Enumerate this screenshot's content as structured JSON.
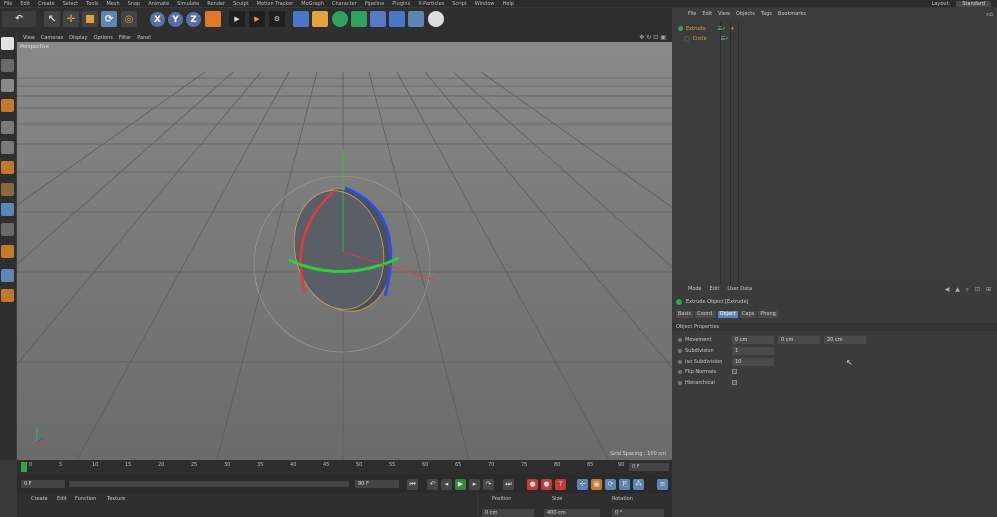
{
  "menubar": {
    "items": [
      "File",
      "Edit",
      "Create",
      "Select",
      "Tools",
      "Mesh",
      "Snap",
      "Animate",
      "Simulate",
      "Render",
      "Sculpt",
      "Motion Tracker",
      "MoGraph",
      "Character",
      "Pipeline",
      "Plugins",
      "X-Particles",
      "Script",
      "Window",
      "Help"
    ],
    "layout_label": "Layout:",
    "layout_value": "Standard"
  },
  "toolbar": {
    "x_label": "X",
    "y_label": "Y",
    "z_label": "Z"
  },
  "viewport": {
    "menu": [
      "View",
      "Cameras",
      "Display",
      "Options",
      "Filter",
      "Panel"
    ],
    "label": "Perspective",
    "grid_spacing": "Grid Spacing : 100 cm"
  },
  "timeline": {
    "ticks": [
      "0",
      "5",
      "10",
      "15",
      "20",
      "25",
      "30",
      "35",
      "40",
      "45",
      "50",
      "55",
      "60",
      "65",
      "70",
      "75",
      "80",
      "85",
      "90"
    ],
    "end_frame": "0 F"
  },
  "transport": {
    "current_frame": "0 F",
    "max_frame": "90 F"
  },
  "material_menu": [
    "Create",
    "Edit",
    "Function",
    "Texture"
  ],
  "coords": {
    "position_label": "Position",
    "size_label": "Size",
    "rotation_label": "Rotation",
    "x_position": "0 cm",
    "x_size": "400 cm",
    "x_rotation": "0 °"
  },
  "object_manager": {
    "menu": [
      "File",
      "Edit",
      "View",
      "Objects",
      "Tags",
      "Bookmarks"
    ],
    "objects": [
      {
        "name": "Extrude",
        "color": "#e5a13b"
      },
      {
        "name": "Circle",
        "color": "#e5a13b"
      }
    ]
  },
  "attribute_manager": {
    "menu": [
      "Mode",
      "Edit",
      "User Data"
    ],
    "title": "Extrude Object [Extrude]",
    "tabs": [
      "Basic",
      "Coord.",
      "Object",
      "Caps",
      "Phong"
    ],
    "active_tab": "Object",
    "section": "Object Properties",
    "props": {
      "movement_label": "Movement",
      "movement_x": "0 cm",
      "movement_y": "0 cm",
      "movement_z": "20 cm",
      "subdivision_label": "Subdivision",
      "subdivision_value": "1",
      "iso_label": "Iso Subdivision",
      "iso_value": "10",
      "flip_label": "Flip Normals",
      "hier_label": "Hierarchical"
    }
  },
  "colors": {
    "accent": "#5d86b6",
    "axis_x": "#e23b3b",
    "axis_y": "#2fcf3a",
    "axis_z": "#2a4fe0"
  }
}
